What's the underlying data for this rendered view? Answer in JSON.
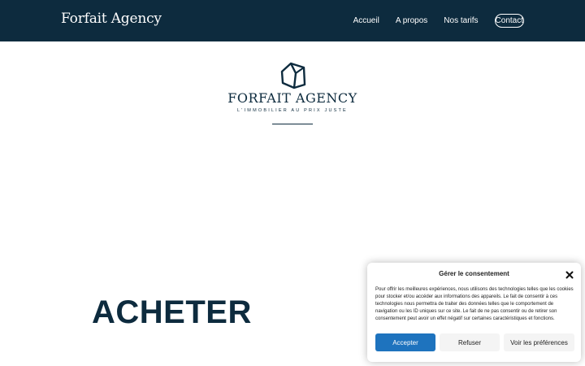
{
  "header": {
    "brand": "Forfait Agency",
    "nav": [
      {
        "label": "Accueil"
      },
      {
        "label": "A propos"
      },
      {
        "label": "Nos tarifs"
      },
      {
        "label": "Contact"
      }
    ],
    "active_item": "Contact",
    "background_color": "#0d2b3e"
  },
  "logo": {
    "title": "FORFAIT AGENCY",
    "subtitle": "L'IMMOBILIER AU PRIX JUSTE",
    "icon": "house-icon"
  },
  "main": {
    "heading": "ACHETER"
  },
  "consent": {
    "title": "Gérer le consentement",
    "close_icon": "close-icon",
    "text": "Pour offrir les meilleures expériences, nous utilisons des technologies telles que les cookies pour stocker et/ou accéder aux informations des appareils. Le fait de consentir à ces technologies nous permettra de traiter des données telles que le comportement de navigation ou les ID uniques sur ce site. Le fait de ne pas consentir ou de retirer son consentement peut avoir un effet négatif sur certaines caractéristiques et fonctions.",
    "accept_label": "Accepter",
    "refuse_label": "Refuser",
    "prefs_label": "Voir les préférences",
    "accept_color": "#1e73be"
  }
}
